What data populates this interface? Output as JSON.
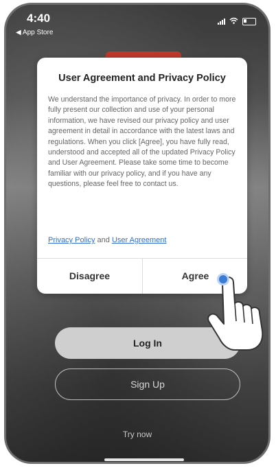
{
  "status_bar": {
    "time": "4:40",
    "back_label": "◀ App Store"
  },
  "dialog": {
    "title": "User Agreement and Privacy Policy",
    "body": "We understand the importance of privacy. In order to more fully present our collection and use of your personal information, we have revised our privacy policy and user agreement in detail in accordance with the latest laws and regulations. When you click [Agree], you have fully read, understood and accepted all of the updated Privacy Policy and User Agreement. Please take some time to become familiar with our privacy policy, and if you have any questions, please feel free to contact us.",
    "privacy_link": "Privacy Policy",
    "and_text": " and ",
    "agreement_link": "User Agreement",
    "disagree_label": "Disagree",
    "agree_label": "Agree"
  },
  "main": {
    "login_label": "Log In",
    "signup_label": "Sign Up",
    "try_now_label": "Try now"
  },
  "colors": {
    "link": "#2f6fd6",
    "tap_indicator": "#3a7bd5",
    "logo": "#c0392b"
  }
}
